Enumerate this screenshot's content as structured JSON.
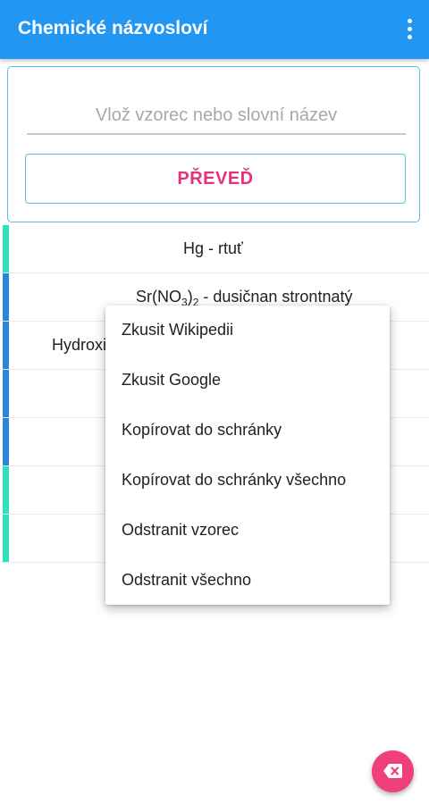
{
  "app": {
    "title": "Chemické názvosloví"
  },
  "colors": {
    "appbar": "#2196f3",
    "accent": "#e2327c",
    "fab": "#f0407c",
    "card_border": "#5dbde9",
    "marker_teal": "#2de0c0",
    "marker_blue": "#2a86db"
  },
  "input": {
    "placeholder": "Vlož vzorec nebo slovní název",
    "value": ""
  },
  "convert_button": {
    "label": "PŘEVEĎ"
  },
  "results": [
    {
      "text": "Hg - rtuť",
      "marker_color": "#2de0c0"
    },
    {
      "formula_pre": "Sr(NO",
      "formula_sub1": "3",
      "formula_mid": ")",
      "formula_sub2": "2",
      "text_rest": " - dusičnan strontnatý",
      "marker_color": "#2a86db"
    },
    {
      "text": "Hydroxid",
      "marker_color": "#2a86db"
    },
    {
      "text": "",
      "marker_color": "#2a86db"
    },
    {
      "text": "",
      "marker_color": "#2a86db"
    },
    {
      "text": "",
      "marker_color": "#2de0c0"
    },
    {
      "text": "",
      "marker_color": "#2de0c0"
    }
  ],
  "context_menu": {
    "items": [
      "Zkusit Wikipedii",
      "Zkusit Google",
      "Kopírovat do schránky",
      "Kopírovat do schránky všechno",
      "Odstranit vzorec",
      "Odstranit všechno"
    ]
  },
  "icons": {
    "overflow": "more-vert-icon",
    "fab": "backspace-icon"
  }
}
